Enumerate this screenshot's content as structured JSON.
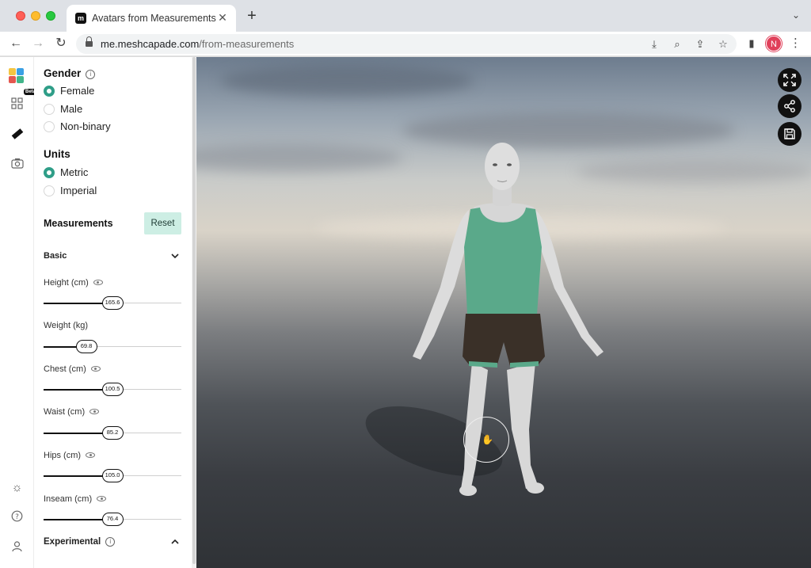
{
  "browser": {
    "tab_title": "Avatars from Measurements",
    "url_host": "me.meshcapade.com",
    "url_path": "/from-measurements",
    "profile_initial": "N"
  },
  "iconbar": {
    "beta_label": "Beta",
    "icons": [
      "dashboard-icon",
      "ruler-icon",
      "camera-icon",
      "sun-icon",
      "help-icon",
      "user-icon"
    ]
  },
  "gender": {
    "title": "Gender",
    "options": [
      "Female",
      "Male",
      "Non-binary"
    ],
    "selected": "Female"
  },
  "units": {
    "title": "Units",
    "options": [
      "Metric",
      "Imperial"
    ],
    "selected": "Metric"
  },
  "measurements": {
    "title": "Measurements",
    "reset_label": "Reset",
    "basic_label": "Basic",
    "experimental_label": "Experimental",
    "items": [
      {
        "label": "Height (cm)",
        "value": "165.6",
        "fraction": 0.5
      },
      {
        "label": "Weight (kg)",
        "value": "69.8",
        "fraction": 0.31
      },
      {
        "label": "Chest (cm)",
        "value": "100.5",
        "fraction": 0.5
      },
      {
        "label": "Waist (cm)",
        "value": "85.2",
        "fraction": 0.5
      },
      {
        "label": "Hips (cm)",
        "value": "105.0",
        "fraction": 0.5
      },
      {
        "label": "Inseam (cm)",
        "value": "76.4",
        "fraction": 0.5
      }
    ]
  },
  "colors": {
    "accent": "#2f9e88",
    "reset_bg": "#cdeee4",
    "tank_top": "#5aa98a",
    "shorts": "#3a3028",
    "skin": "#dcdcdc"
  }
}
